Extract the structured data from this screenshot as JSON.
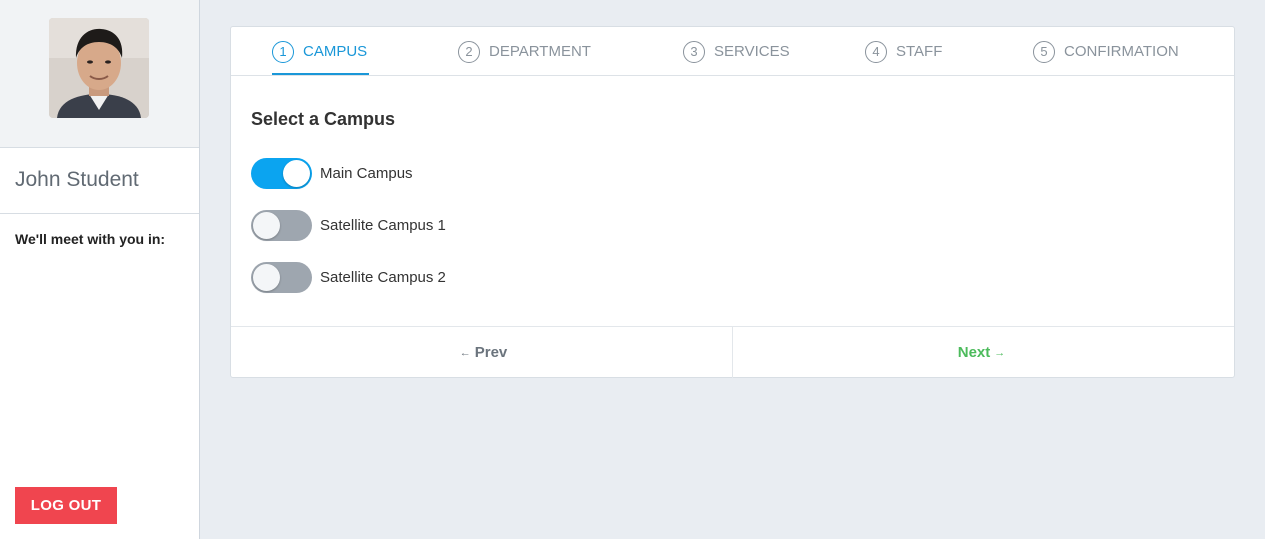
{
  "user": {
    "name": "John Student",
    "meet_label": "We'll meet with you in:",
    "logout_label": "LOG OUT"
  },
  "steps": [
    {
      "num": "1",
      "label": "CAMPUS",
      "active": true
    },
    {
      "num": "2",
      "label": "DEPARTMENT",
      "active": false
    },
    {
      "num": "3",
      "label": "SERVICES",
      "active": false
    },
    {
      "num": "4",
      "label": "STAFF",
      "active": false
    },
    {
      "num": "5",
      "label": "CONFIRMATION",
      "active": false
    }
  ],
  "section": {
    "title": "Select a Campus"
  },
  "options": [
    {
      "label": "Main Campus",
      "selected": true
    },
    {
      "label": "Satellite Campus 1",
      "selected": false
    },
    {
      "label": "Satellite Campus 2",
      "selected": false
    }
  ],
  "nav": {
    "prev_label": "Prev",
    "next_label": "Next"
  },
  "colors": {
    "accent": "#1a97d8",
    "toggle_on": "#0ba4f0",
    "toggle_off": "#9ea6af",
    "logout": "#f0454f",
    "next": "#4cbb5c"
  },
  "icons": {
    "prev": "arrow-left-icon",
    "next": "arrow-right-icon"
  }
}
